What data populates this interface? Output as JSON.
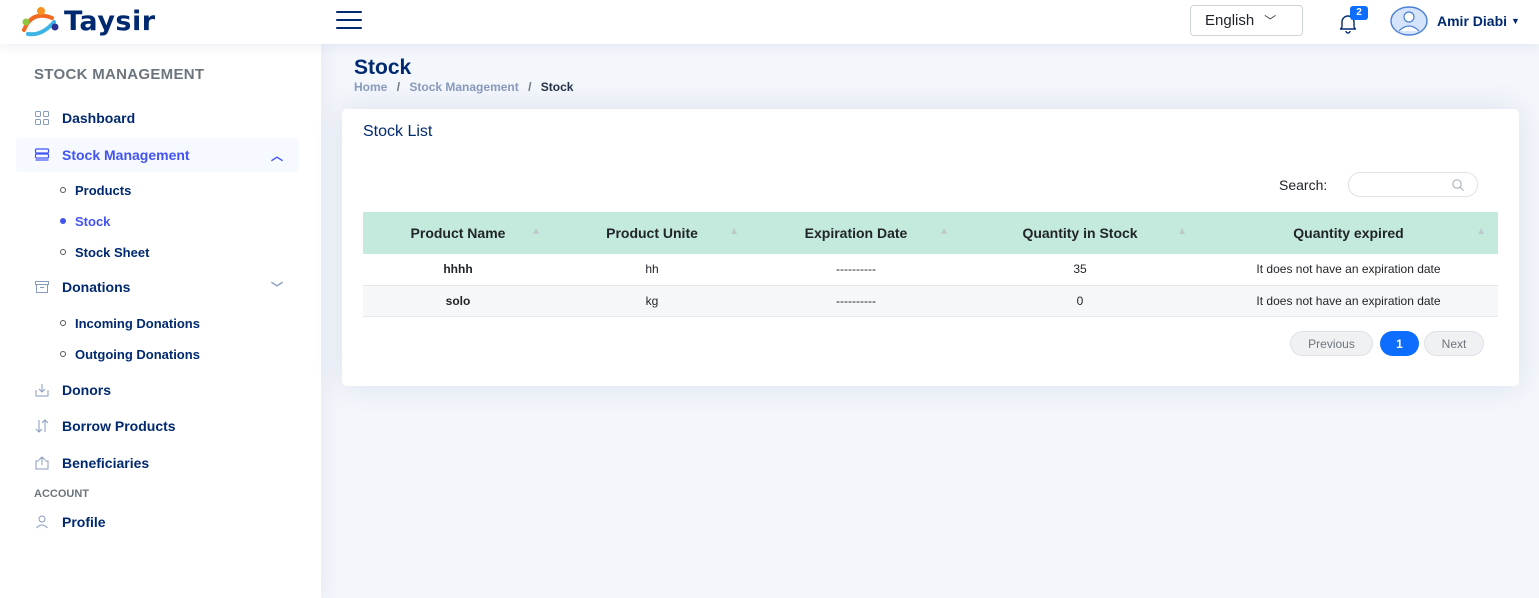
{
  "app": {
    "brand": "Taysir"
  },
  "header": {
    "language": "English",
    "notification_count": "2",
    "user_name": "Amir Diabi"
  },
  "sidebar": {
    "heading": "STOCK MANAGEMENT",
    "items": {
      "dashboard": "Dashboard",
      "stock_management": "Stock Management",
      "products": "Products",
      "stock": "Stock",
      "stock_sheet": "Stock Sheet",
      "donations": "Donations",
      "incoming_donations": "Incoming Donations",
      "outgoing_donations": "Outgoing Donations",
      "donors": "Donors",
      "borrow_products": "Borrow Products",
      "beneficiaries": "Beneficiaries"
    },
    "account_heading": "ACCOUNT",
    "profile": "Profile"
  },
  "page": {
    "title": "Stock",
    "breadcrumb": [
      "Home",
      "Stock Management",
      "Stock"
    ]
  },
  "card": {
    "title": "Stock List",
    "search_label": "Search:",
    "columns": [
      "Product Name",
      "Product Unite",
      "Expiration Date",
      "Quantity in Stock",
      "Quantity expired"
    ],
    "rows": [
      [
        "hhhh",
        "hh",
        "----------",
        "35",
        "It does not have an expiration date"
      ],
      [
        "solo",
        "kg",
        "----------",
        "0",
        "It does not have an expiration date"
      ]
    ],
    "pagination": {
      "previous": "Previous",
      "current": "1",
      "next": "Next"
    }
  },
  "colors": {
    "accent": "#4154f1",
    "navy": "#012970",
    "table_header": "#c4e9dd",
    "pager_active": "#0d6efd"
  }
}
